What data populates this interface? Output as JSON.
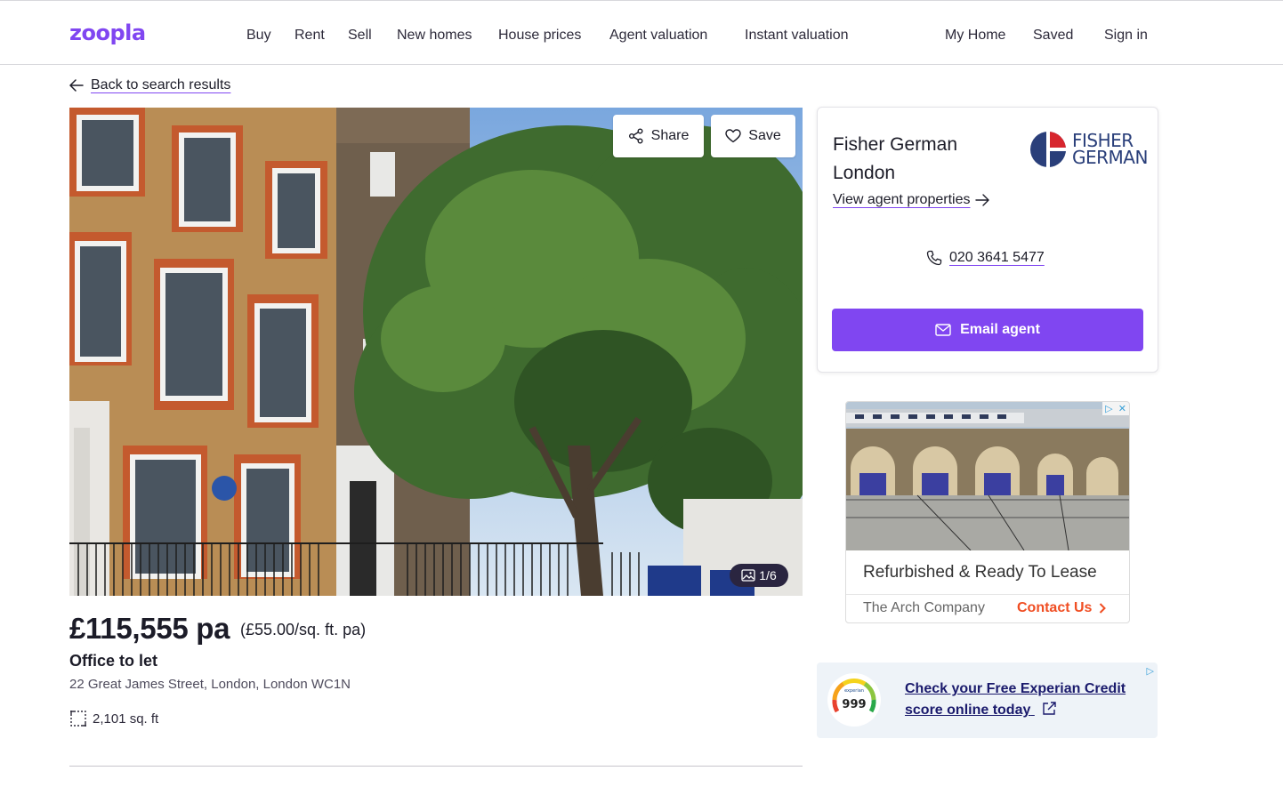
{
  "brand": {
    "logo_text": "zoopla",
    "accent": "#8046f1"
  },
  "nav": {
    "items": [
      "Buy",
      "Rent",
      "Sell",
      "New homes",
      "House prices",
      "Agent valuation",
      "Instant valuation"
    ],
    "right_items": [
      "My Home",
      "Saved",
      "Sign in"
    ]
  },
  "back_link": "Back to search results",
  "gallery": {
    "share_label": "Share",
    "save_label": "Save",
    "counter": "1/6"
  },
  "listing": {
    "price": "£115,555 pa",
    "price_per_sqft": "(£55.00/sq. ft. pa)",
    "property_type": "Office to let",
    "address": "22 Great James Street, London, London WC1N",
    "size": "2,101 sq. ft"
  },
  "agent": {
    "name": "Fisher German London",
    "logo_line1": "FISHER",
    "logo_line2": "GERMAN",
    "view_properties": "View agent properties",
    "phone": "020 3641 5477",
    "email_button": "Email agent"
  },
  "ad_primary": {
    "headline": "Refurbished & Ready To Lease",
    "advertiser": "The Arch Company",
    "cta": "Contact Us",
    "cta_color": "#f04e23"
  },
  "ad_secondary": {
    "gauge_value": "999",
    "gauge_brand": "experian",
    "text": "Check your Free Experian Credit score online today"
  }
}
